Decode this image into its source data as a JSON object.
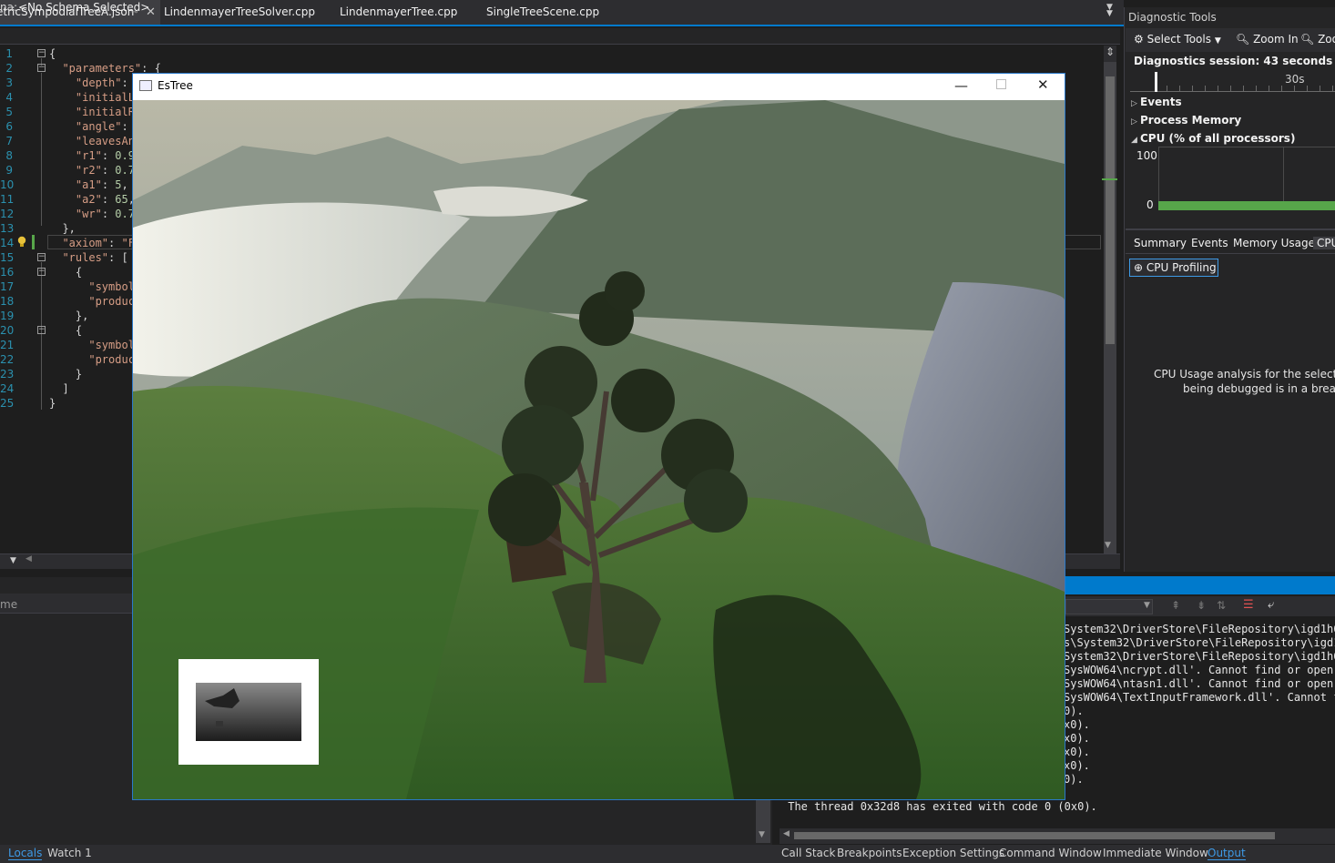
{
  "tabs": [
    {
      "label": "etricSympodialTreeA.json",
      "active": true
    },
    {
      "label": "LindenmayerTreeSolver.cpp"
    },
    {
      "label": "LindenmayerTree.cpp"
    },
    {
      "label": "SingleTreeScene.cpp"
    }
  ],
  "tab_pin": "⊸",
  "tab_close": "✕",
  "schema": {
    "label": "na:",
    "value": "<No Schema Selected>"
  },
  "editor": {
    "line_numbers": [
      "1",
      "2",
      "3",
      "4",
      "5",
      "6",
      "7",
      "8",
      "9",
      "10",
      "11",
      "12",
      "13",
      "14",
      "15",
      "16",
      "17",
      "18",
      "19",
      "20",
      "21",
      "22",
      "23",
      "24",
      "25"
    ],
    "lines": [
      "{",
      "  \"parameters\": {",
      "    \"depth\": ",
      "    \"initialL",
      "    \"initialR",
      "    \"angle\": ",
      "    \"leavesAn",
      "    \"r1\": 0.9",
      "    \"r2\": 0.7",
      "    \"a1\": 5,",
      "    \"a2\": 65,",
      "    \"wr\": 0.7",
      "  },",
      "  \"axiom\": \"F",
      "  \"rules\": [",
      "    {",
      "      \"symbol",
      "      \"produc",
      "    },",
      "    {",
      "      \"symbol",
      "      \"produc",
      "    }",
      "  ]",
      "}"
    ]
  },
  "locals": {
    "column": "me"
  },
  "bottom_left_tabs": [
    "Locals",
    "Watch 1"
  ],
  "bottom_right_tabs": [
    "Call Stack",
    "Breakpoints",
    "Exception Settings",
    "Command Window",
    "Immediate Window",
    "Output"
  ],
  "diagnostics": {
    "title": "Diagnostic Tools",
    "select_tools": "Select Tools",
    "zoom_in": "Zoom In",
    "zoom_out": "Zoo",
    "session": "Diagnostics session: 43 seconds",
    "timeline_label": "30s",
    "sections": [
      "Events",
      "Process Memory",
      "CPU (% of all processors)"
    ],
    "cpu_max": "100",
    "cpu_min": "0",
    "cpu_usage_level": 0.02,
    "tabs": [
      "Summary",
      "Events",
      "Memory Usage",
      "CPU"
    ],
    "cpu_profiling": "CPU Profiling",
    "message_line1": "CPU Usage analysis for the selected ra",
    "message_line2": "being debugged is in a break st"
  },
  "output": {
    "lines": [
      "System32\\DriverStore\\FileRepository\\igd1h64",
      "s\\System32\\DriverStore\\FileRepository\\igd1h",
      "System32\\DriverStore\\FileRepository\\igd1h64",
      "SysWOW64\\ncrypt.dll'. Cannot find or open t",
      "SysWOW64\\ntasn1.dll'. Cannot find or open t",
      "SysWOW64\\TextInputFramework.dll'. Cannot fi",
      "0).",
      "x0).",
      "x0).",
      "x0).",
      "x0).",
      "0).",
      " The thread 0x32d8 has exited with code 0 (0x0)."
    ]
  },
  "estree": {
    "title": "EsTree",
    "minimize": "—",
    "close": "✕"
  },
  "colors": {
    "accent": "#007acc",
    "string": "#d69d85",
    "line_number": "#2b91af",
    "cpu_fill": "#57a64a"
  }
}
